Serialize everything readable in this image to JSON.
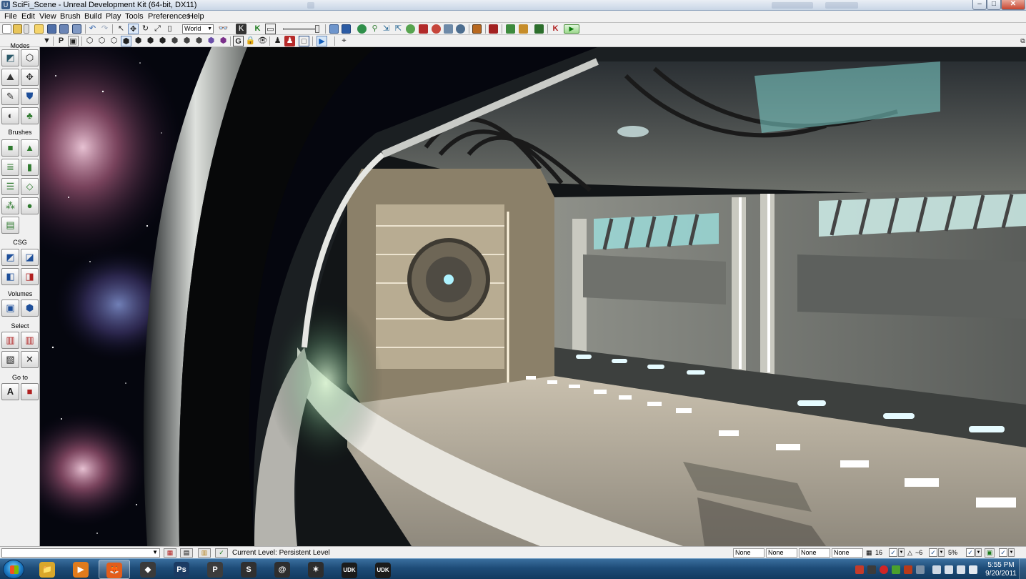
{
  "window": {
    "title": "SciFi_Scene - Unreal Development Kit (64-bit, DX11)",
    "controls": {
      "minimize": "–",
      "maximize": "□",
      "close": "✕"
    }
  },
  "menu": {
    "items": [
      "File",
      "Edit",
      "View",
      "Brush",
      "Build",
      "Play",
      "Tools",
      "Preferences",
      "Help"
    ]
  },
  "toolbar": {
    "coordinate_system": "World",
    "play_icon": "play-in-editor-icon",
    "play_symbol": "▶"
  },
  "left_panel": {
    "sections": {
      "modes": "Modes",
      "brushes": "Brushes",
      "csg": "CSG",
      "volumes": "Volumes",
      "select": "Select",
      "goto": "Go to"
    }
  },
  "status": {
    "current_level": "Current Level:  Persistent Level",
    "none_fields": [
      "None",
      "None",
      "None",
      "None"
    ],
    "grid_size": "16",
    "rotation_snap": "~6",
    "scale_snap": "5%",
    "checkbox_mark": "✓"
  },
  "taskbar": {
    "items": [
      {
        "name": "windows-explorer",
        "label": "📁",
        "color": "#d9a72b"
      },
      {
        "name": "media-player",
        "label": "▶",
        "color": "#e07b1c"
      },
      {
        "name": "firefox",
        "label": "🦊",
        "color": "#e35d1a"
      },
      {
        "name": "unity",
        "label": "◆",
        "color": "#3a3a3a"
      },
      {
        "name": "photoshop",
        "label": "Ps",
        "color": "#1b3b63"
      },
      {
        "name": "perforce",
        "label": "P",
        "color": "#3c3c3c"
      },
      {
        "name": "app-s",
        "label": "S",
        "color": "#303030"
      },
      {
        "name": "app-swirl",
        "label": "@",
        "color": "#2e2e2e"
      },
      {
        "name": "mixamo",
        "label": "✶",
        "color": "#2d2d2d"
      },
      {
        "name": "udk-1",
        "label": "UDK",
        "color": "#1b1b1b"
      },
      {
        "name": "udk-2",
        "label": "UDK",
        "color": "#1b1b1b"
      }
    ],
    "clock_time": "5:55 PM",
    "clock_date": "9/20/2011"
  },
  "colors": {
    "titlebar": "#c9d6e6",
    "toolbar_bg": "#f0f0f0",
    "taskbar": "#1e4c78",
    "viewport_bg": "#040610"
  }
}
